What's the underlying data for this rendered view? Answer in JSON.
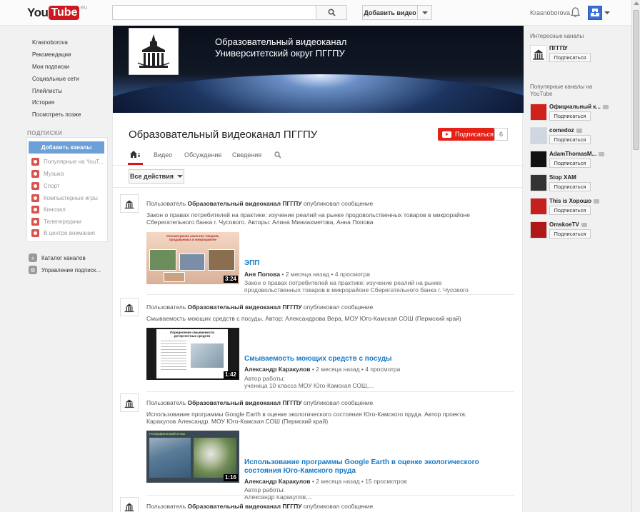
{
  "header": {
    "logo_you": "You",
    "logo_tube": "Tube",
    "logo_region": "RU",
    "search_placeholder": "",
    "upload_label": "Добавить видео",
    "username": "Krasnoborova"
  },
  "guide": {
    "items": [
      {
        "label": "Krasnoborova"
      },
      {
        "label": "Рекомендации"
      },
      {
        "label": "Мои подписки"
      },
      {
        "label": "Социальные сети"
      },
      {
        "label": "Плейлисты"
      },
      {
        "label": "История"
      },
      {
        "label": "Посмотреть позже"
      }
    ],
    "subscriptions_heading": "ПОДПИСКИ",
    "add_channels_label": "Добавить каналы",
    "subscriptions": [
      {
        "label": "Популярные на YouT..."
      },
      {
        "label": "Музыка"
      },
      {
        "label": "Спорт"
      },
      {
        "label": "Компьютерные игры"
      },
      {
        "label": "Кинозал"
      },
      {
        "label": "Телепередачи"
      },
      {
        "label": "В центре внимания"
      }
    ],
    "tools": [
      {
        "label": "Каталог каналов"
      },
      {
        "label": "Управление подписк..."
      }
    ]
  },
  "channel": {
    "banner_line1": "Образовательный видеоканал",
    "banner_line2": "Университетский округ ПГГПУ",
    "name": "Образовательный видеоканал ПГГПУ",
    "subscribe_label": "Подписаться",
    "subscriber_count": "6",
    "tabs": [
      {
        "label": "Видео"
      },
      {
        "label": "Обсуждение"
      },
      {
        "label": "Сведения"
      }
    ],
    "actions_label": "Все действия"
  },
  "feed": [
    {
      "user_prefix": "Пользователь",
      "user_name": "Образовательный видеоканал ПГГПУ",
      "action": "опубликовал сообщение",
      "description": "Закон о правах потребителей на практике: изучение реалий на рынке продовольственных товаров в микрорайоне Сберегательного банка г. Чусового. Авторы: Алина Миниахметова, Анна Попова",
      "video_title": "ЭПП",
      "duration": "3:24",
      "author": "Аня Попова",
      "age": "2 месяца назад",
      "views": "4 просмотра",
      "video_desc": "Закон о правах потребителей на практике: изучение реалий на рынке продовольственных товаров в микрорайоне Сберегательного банка г. Чусового",
      "thumb_text": "Рассмотрение качества товаров, продаваемых в микрорайоне"
    },
    {
      "user_prefix": "Пользователь",
      "user_name": "Образовательный видеоканал ПГГПУ",
      "action": "опубликовал сообщение",
      "description": "Смываемость моющих средств с посуды. Автор: Александрова Вера, МОУ Юго-Камская СОШ (Пермский край)",
      "video_title": "Смываемость моющих средств с посуды",
      "duration": "1:42",
      "author": "Александр Каракулов",
      "age": "2 месяца назад",
      "views": "4 просмотра",
      "video_desc": "Автор работы:\nученица 10 класса МОУ Юго-Камская СОШ,...",
      "thumb_text": "Определение смываемости детергентных средств"
    },
    {
      "user_prefix": "Пользователь",
      "user_name": "Образовательный видеоканал ПГГПУ",
      "action": "опубликовал сообщение",
      "description": "Использование программы Google Earth в оценке экологического состояния Юго-Камского пруда. Автор проекта: Каракулов Александр. МОУ Юго-Камская СОШ (Пермский край)",
      "video_title": "Использование программы Google Earth в оценке экологического состояния Юго-Камского пруда",
      "duration": "1:16",
      "author": "Александр Каракулов",
      "age": "2 месяца назад",
      "views": "15 просмотров",
      "video_desc": "Автор работы:\nАлександр Каракулов,...",
      "thumb_text": "Географический атлас"
    },
    {
      "user_prefix": "Пользователь",
      "user_name": "Образовательный видеоканал ПГГПУ",
      "action": "опубликовал сообщение"
    }
  ],
  "right": {
    "interesting_heading": "Интересные каналы",
    "interesting": [
      {
        "name": "ПГГПУ",
        "button": "Подписаться"
      }
    ],
    "popular_heading": "Популярные каналы на YouTube",
    "popular": [
      {
        "name": "Официальный к...",
        "button": "Подписаться",
        "color": "#d0211c"
      },
      {
        "name": "comedoz",
        "button": "Подписаться",
        "color": "#cfd6e0"
      },
      {
        "name": "AdamThomasM...",
        "button": "Подписаться",
        "color": "#111111"
      },
      {
        "name": "Stop ХАМ",
        "button": "Подписаться",
        "color": "#333333"
      },
      {
        "name": "This is Хорошо",
        "button": "Подписаться",
        "color": "#c51f1f"
      },
      {
        "name": "OmskoeTV",
        "button": "Подписаться",
        "color": "#b01818"
      }
    ]
  },
  "colors": {
    "accent": "#cc181e",
    "link": "#167ac6",
    "subscribe_bg": "#e62117"
  }
}
